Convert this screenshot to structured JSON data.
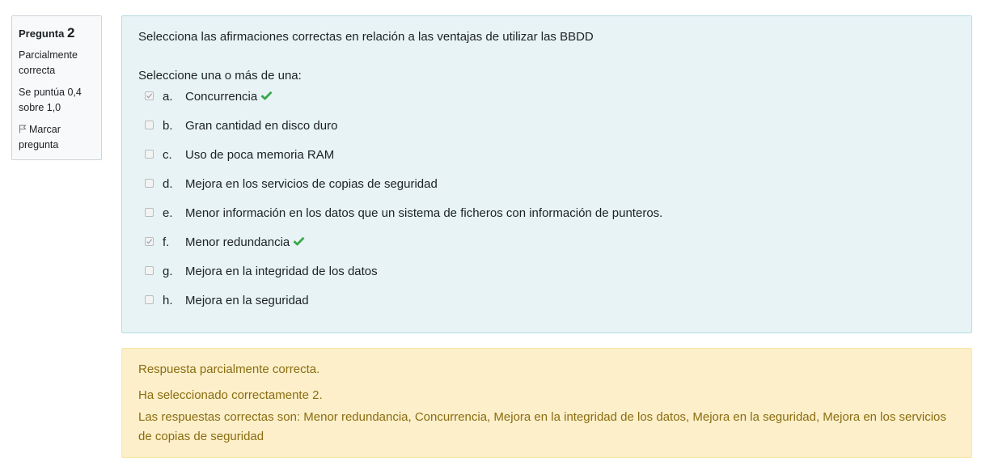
{
  "info": {
    "question_label": "Pregunta",
    "question_number": "2",
    "state": "Parcialmente correcta",
    "grade": "Se puntúa 0,4 sobre 1,0",
    "flag_label": "Marcar pregunta"
  },
  "question": {
    "text": "Selecciona las afirmaciones correctas en relación a las ventajas de utilizar las BBDD",
    "prompt": "Seleccione una o más de una:",
    "options": [
      {
        "letter": "a.",
        "text": "Concurrencia",
        "checked": true,
        "correct": true
      },
      {
        "letter": "b.",
        "text": "Gran cantidad en disco duro",
        "checked": false
      },
      {
        "letter": "c.",
        "text": "Uso de poca memoria RAM",
        "checked": false
      },
      {
        "letter": "d.",
        "text": "Mejora en los servicios de copias de seguridad",
        "checked": false
      },
      {
        "letter": "e.",
        "text": "Menor información en los datos que un sistema de ficheros con información de punteros.",
        "checked": false
      },
      {
        "letter": "f.",
        "text": "Menor redundancia",
        "checked": true,
        "correct": true
      },
      {
        "letter": "g.",
        "text": "Mejora en la integridad de los datos",
        "checked": false
      },
      {
        "letter": "h.",
        "text": "Mejora en la seguridad",
        "checked": false
      }
    ]
  },
  "feedback": {
    "summary": "Respuesta parcialmente correcta.",
    "num_correct": "Ha seleccionado correctamente 2.",
    "right_answer": "Las respuestas correctas son: Menor redundancia, Concurrencia, Mejora en la integridad de los datos, Mejora en la seguridad, Mejora en los servicios de copias de seguridad"
  },
  "colors": {
    "formulation_bg": "#e7f3f5",
    "feedback_bg": "#fcefc9",
    "feedback_text": "#8a6d12",
    "correct_tick": "#3aa64b"
  },
  "icons": {
    "flag": "flag-icon",
    "correct": "checkmark-icon"
  }
}
